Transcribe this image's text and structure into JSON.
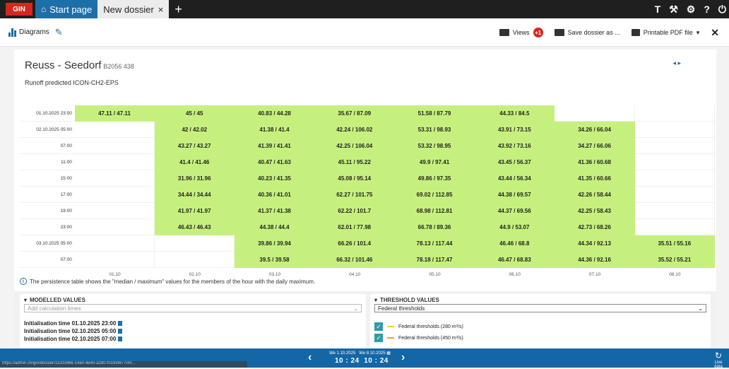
{
  "tabs": {
    "logo": "GIN",
    "home_label": "Start page",
    "dossier_label": "New dossier",
    "close_glyph": "×",
    "add_glyph": "+"
  },
  "top_icons": [
    "T",
    "⚒",
    "⚙",
    "?",
    "⏻"
  ],
  "toolbar": {
    "diagrams_label": "Diagrams",
    "views_label": "Views",
    "views_badge": "+1",
    "save_label": "Save dossier as ...",
    "pdf_label": "Printable PDF file",
    "pdf_caret": "▾",
    "close_glyph": "✕"
  },
  "station": {
    "name": "Reuss - Seedorf",
    "code": "B2056 438",
    "subtitle": "Runoff predicted ICON-CH2-EPS",
    "corner_mark": "◂ ▸"
  },
  "table": {
    "columns": [
      "01.10",
      "02.10",
      "03.10",
      "04.10",
      "05.10",
      "06.10",
      "07.10",
      "08.10"
    ],
    "rows": [
      {
        "label": "01.10.2025 23:00",
        "cells": [
          "47.11 / 47.11",
          "45 / 45",
          "40.83 / 44.28",
          "35.67 / 87.09",
          "51.58 / 87.79",
          "44.33 / 84.5",
          "",
          ""
        ]
      },
      {
        "label": "02.10.2025 05:00",
        "cells": [
          "",
          "42 / 42.02",
          "41.38 / 41.4",
          "42.24 / 106.02",
          "53.31 / 98.93",
          "43.91 / 73.15",
          "34.26 / 66.04",
          ""
        ]
      },
      {
        "label": "07:00",
        "cells": [
          "",
          "43.27 / 43.27",
          "41.39 / 41.41",
          "42.25 / 106.04",
          "53.32 / 98.95",
          "43.92 / 73.16",
          "34.27 / 66.06",
          ""
        ]
      },
      {
        "label": "11:00",
        "cells": [
          "",
          "41.4 / 41.46",
          "40.47 / 41.63",
          "45.11 / 95.22",
          "49.9 / 97.41",
          "43.45 / 56.37",
          "41.36 / 60.68",
          ""
        ]
      },
      {
        "label": "15:00",
        "cells": [
          "",
          "31.96 / 31.96",
          "40.23 / 41.35",
          "45.08 / 95.14",
          "49.86 / 97.35",
          "43.44 / 56.34",
          "41.35 / 60.66",
          ""
        ]
      },
      {
        "label": "17:00",
        "cells": [
          "",
          "34.44 / 34.44",
          "40.36 / 41.01",
          "62.27 / 101.75",
          "69.02 / 112.85",
          "44.38 / 69.57",
          "42.26 / 58.44",
          ""
        ]
      },
      {
        "label": "19:00",
        "cells": [
          "",
          "41.97 / 41.97",
          "41.37 / 41.38",
          "62.22 / 101.7",
          "68.98 / 112.81",
          "44.37 / 69.56",
          "42.25 / 58.43",
          ""
        ]
      },
      {
        "label": "23:00",
        "cells": [
          "",
          "46.43 / 46.43",
          "44.38 / 44.4",
          "62.01 / 77.98",
          "66.78 / 89.36",
          "44.9 / 53.07",
          "42.73 / 68.26",
          ""
        ]
      },
      {
        "label": "03.10.2025 05:00",
        "cells": [
          "",
          "",
          "39.86 / 39.94",
          "66.26 / 101.4",
          "78.13 / 117.44",
          "46.46 / 68.8",
          "44.34 / 92.13",
          "35.51 / 55.16"
        ]
      },
      {
        "label": "07:00",
        "cells": [
          "",
          "",
          "39.5 / 39.58",
          "66.32 / 101.46",
          "78.18 / 117.47",
          "46.47 / 68.83",
          "44.36 / 92.16",
          "35.52 / 55.21"
        ]
      }
    ],
    "highlight_color": "#c6f07e"
  },
  "note": "The persistence table shows the \"median / maximum\" values for the members of the hour with the daily maximum.",
  "modelled": {
    "header": "MODELLED VALUES",
    "placeholder": "Add calculation times",
    "items": [
      "Initialisation time 01.10.2025 23:00",
      "Initialisation time 02.10.2025 05:00",
      "Initialisation time 02.10.2025 07:00"
    ]
  },
  "thresholds": {
    "header": "THRESHOLD VALUES",
    "selected": "Federal thresholds",
    "items": [
      {
        "label": "Federal thresholds (280 m³/s)",
        "color": "#f2d23c"
      },
      {
        "label": "Federal thresholds (450 m³/s)",
        "color": "#f0a030"
      }
    ]
  },
  "bottom": {
    "date_from": "We 1.10.2025",
    "date_to": "We 8.10.2025",
    "time_from": "10 : 24",
    "time_to": "10 : 24",
    "live_label": "Live data",
    "url": "https://admin.ch/gin/dossier/11c03966-14a0-4e40-a280-f0195f87700/..."
  }
}
